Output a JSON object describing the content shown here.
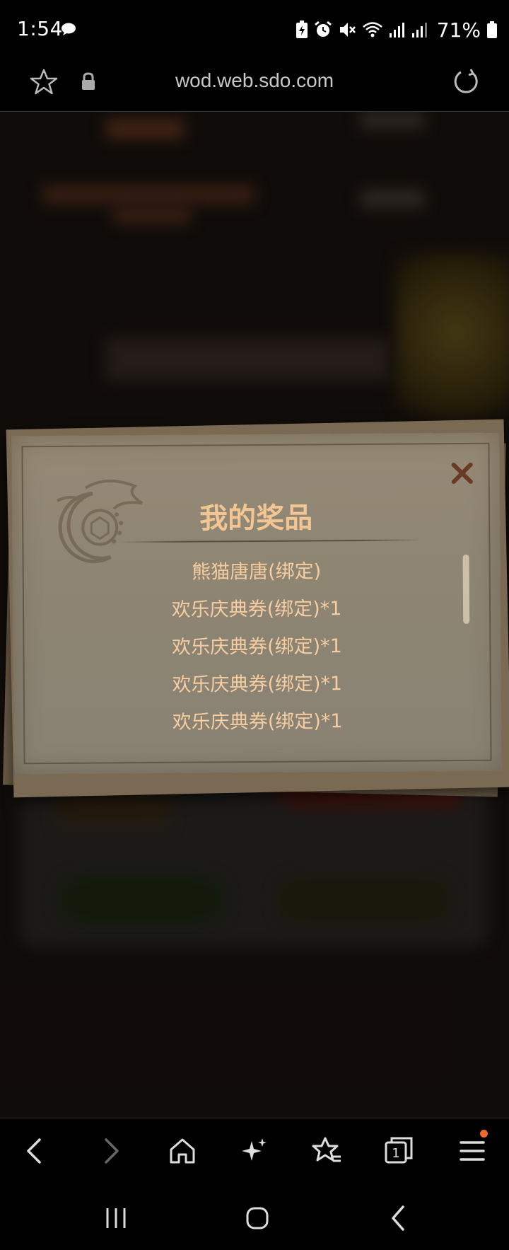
{
  "status_bar": {
    "time": "1:54",
    "battery": "71%",
    "icons": [
      "chat-bubble-icon",
      "battery-saver-icon",
      "alarm-icon",
      "mute-icon",
      "wifi-icon",
      "signal-icon"
    ]
  },
  "browser": {
    "url": "wod.web.sdo.com",
    "icons": [
      "star-icon",
      "lock-icon",
      "reload-icon"
    ]
  },
  "modal": {
    "title": "我的奖品",
    "items": [
      "熊猫唐唐(绑定)",
      "欢乐庆典券(绑定)*1",
      "欢乐庆典券(绑定)*1",
      "欢乐庆典券(绑定)*1",
      "欢乐庆典券(绑定)*1"
    ],
    "colors": {
      "title": "#f2c693",
      "item": "#f6cda0",
      "paper": "#8e8573",
      "close": "#6b3a22"
    }
  },
  "toolbar": {
    "buttons": [
      "back-icon",
      "forward-icon",
      "home-icon",
      "ai-sparkle-icon",
      "bookmarks-icon",
      "tabs-icon",
      "menu-icon"
    ],
    "tab_count": "1",
    "accent": "#ef6a2c"
  },
  "navbar": {
    "buttons": [
      "recents-icon",
      "home-circle-icon",
      "nav-back-icon"
    ]
  }
}
